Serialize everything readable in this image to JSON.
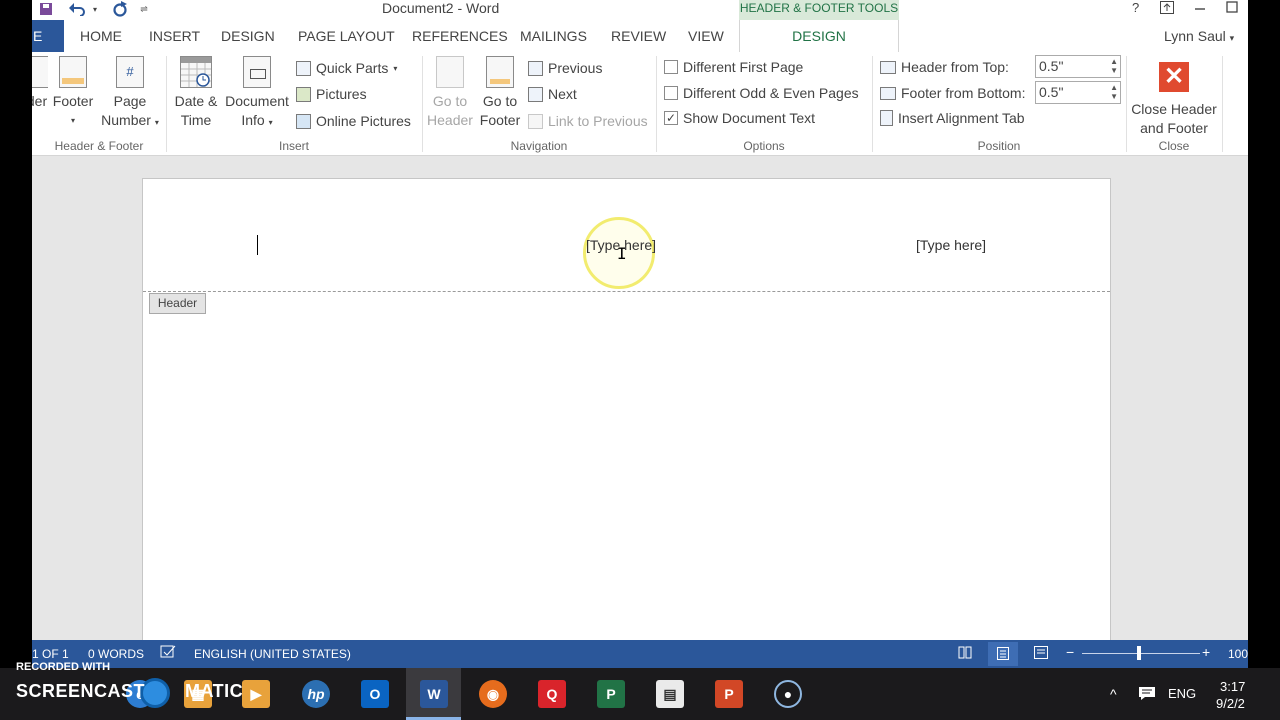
{
  "titlebar": {
    "doc_title": "Document2 - Word",
    "contextual_header": "HEADER & FOOTER TOOLS",
    "help": "?",
    "qat_menu": "⇌"
  },
  "tabs": {
    "file": "E",
    "items": [
      "HOME",
      "INSERT",
      "DESIGN",
      "PAGE LAYOUT",
      "REFERENCES",
      "MAILINGS",
      "REVIEW",
      "VIEW"
    ],
    "active": "DESIGN",
    "user": "Lynn Saul"
  },
  "ribbon": {
    "header_footer": {
      "header_label": "der",
      "footer_label": "Footer",
      "page_number_line1": "Page",
      "page_number_line2": "Number",
      "group": "Header & Footer"
    },
    "insert": {
      "date_line1": "Date &",
      "date_line2": "Time",
      "docinfo_line1": "Document",
      "docinfo_line2": "Info",
      "quick_parts": "Quick Parts",
      "pictures": "Pictures",
      "online_pictures": "Online Pictures",
      "group": "Insert"
    },
    "navigation": {
      "goto_header_line1": "Go to",
      "goto_header_line2": "Header",
      "goto_footer_line1": "Go to",
      "goto_footer_line2": "Footer",
      "previous": "Previous",
      "next": "Next",
      "link_previous": "Link to Previous",
      "group": "Navigation"
    },
    "options": {
      "different_first": "Different First Page",
      "different_odd_even": "Different Odd & Even Pages",
      "show_doc_text": "Show Document Text",
      "different_first_checked": false,
      "different_odd_even_checked": false,
      "show_doc_text_checked": true,
      "group": "Options"
    },
    "position": {
      "header_from_top_label": "Header from Top:",
      "header_from_top_value": "0.5\"",
      "footer_from_bottom_label": "Footer from Bottom:",
      "footer_from_bottom_value": "0.5\"",
      "insert_alignment_tab": "Insert Alignment Tab",
      "group": "Position"
    },
    "close": {
      "close_line1": "Close Header",
      "close_line2": "and Footer",
      "group": "Close"
    }
  },
  "document": {
    "placeholder_center": "[Type here]",
    "placeholder_right": "[Type here]",
    "header_tag": "Header"
  },
  "statusbar": {
    "page": "1 OF 1",
    "words": "0 WORDS",
    "language": "ENGLISH (UNITED STATES)",
    "zoom_minus": "−",
    "zoom_plus": "+",
    "zoom": "100"
  },
  "taskbar": {
    "recorded_with": "RECORDED WITH",
    "screencast": "SCREENCAST",
    "matic": "MATIC",
    "lang": "ENG",
    "time": "3:17",
    "date": "9/2/2"
  },
  "colors": {
    "word_blue": "#2b579a",
    "design_green": "#217346",
    "close_red": "#e04a2f"
  }
}
